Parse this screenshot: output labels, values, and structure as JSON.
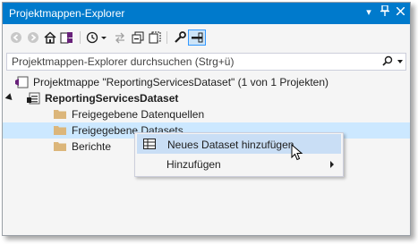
{
  "window": {
    "title": "Projektmappen-Explorer"
  },
  "toolbar": {
    "buttons": [
      "back-icon",
      "forward-icon",
      "home-icon",
      "switch-views-icon",
      "history-icon",
      "sync-icon",
      "collapse-all-icon",
      "show-all-files-icon",
      "properties-icon",
      "preview-icon"
    ]
  },
  "search": {
    "placeholder": "Projektmappen-Explorer durchsuchen (Strg+ü)"
  },
  "tree": {
    "solution": "Projektmappe \"ReportingServicesDataset\" (1 von 1 Projekten)",
    "project": "ReportingServicesDataset",
    "folders": [
      "Freigegebene Datenquellen",
      "Freigegebene Datasets",
      "Berichte"
    ]
  },
  "context_menu": {
    "items": [
      {
        "label": "Neues Dataset hinzufügen",
        "icon": "dataset-icon"
      },
      {
        "label": "Hinzufügen",
        "has_submenu": true
      }
    ]
  },
  "colors": {
    "accent": "#007acc",
    "selection": "#cce8ff",
    "menu_highlight": "#c9def5",
    "folder": "#dcb67a"
  }
}
